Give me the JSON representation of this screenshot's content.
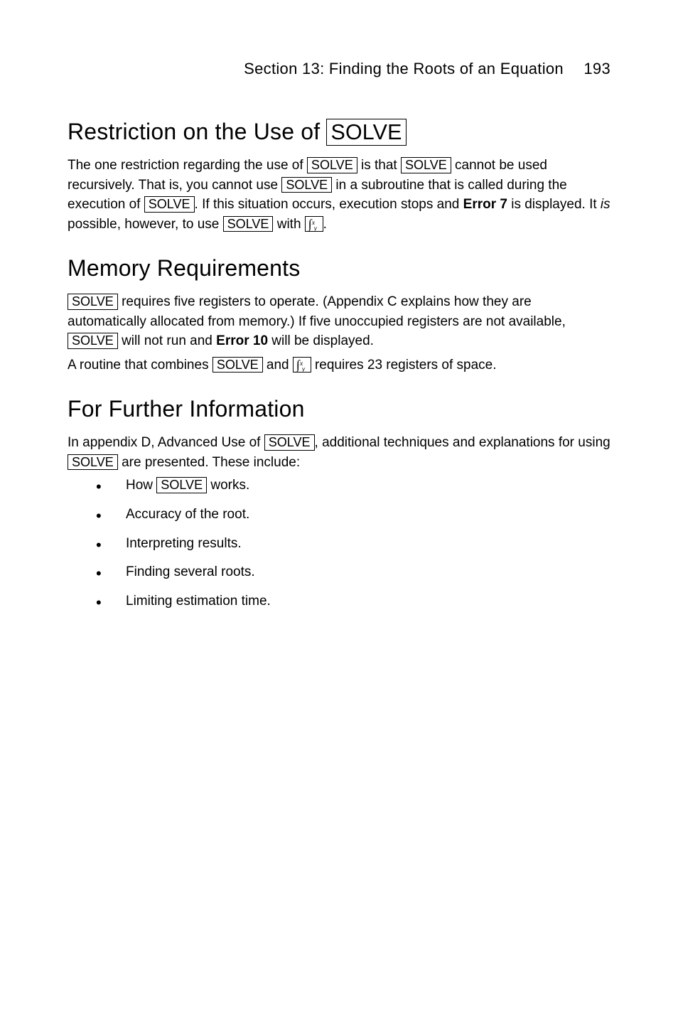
{
  "header": {
    "section_title": "Section 13: Finding the Roots of an Equation",
    "page_number": "193"
  },
  "keys": {
    "solve": "SOLVE",
    "integrate": "∫"
  },
  "sections": {
    "restriction": {
      "heading_pre": "Restriction on the Use of ",
      "p1a": "The one restriction regarding the use of ",
      "p1b": " is that ",
      "p1c": " cannot be used recursively. That is, you cannot use ",
      "p1d": " in a subroutine that is called during the execution of ",
      "p1e": ". If this situation occurs, execution stops and ",
      "p1f": "Error 7",
      "p1g": " is displayed. It ",
      "p1h": "is",
      "p1i": " possible, however, to use ",
      "p1j": " with ",
      "p1k": "."
    },
    "memory": {
      "heading": "Memory Requirements",
      "p1a": " requires five registers to operate. (Appendix C explains how they are automatically allocated from memory.) If five unoccupied registers are not available, ",
      "p1b": " will not run and ",
      "p1c": "Error 10",
      "p1d": " will be displayed.",
      "p2a": "A routine that combines ",
      "p2b": " and ",
      "p2c": " requires 23 registers of space."
    },
    "further": {
      "heading": "For Further Information",
      "p1a": "In appendix D, Advanced Use of ",
      "p1b": ", additional techniques and explanations for using ",
      "p1c": " are presented. These include:",
      "bullets": {
        "b1a": "How ",
        "b1b": " works.",
        "b2": "Accuracy of the root.",
        "b3": "Interpreting results.",
        "b4": "Finding several roots.",
        "b5": "Limiting estimation time."
      }
    }
  }
}
